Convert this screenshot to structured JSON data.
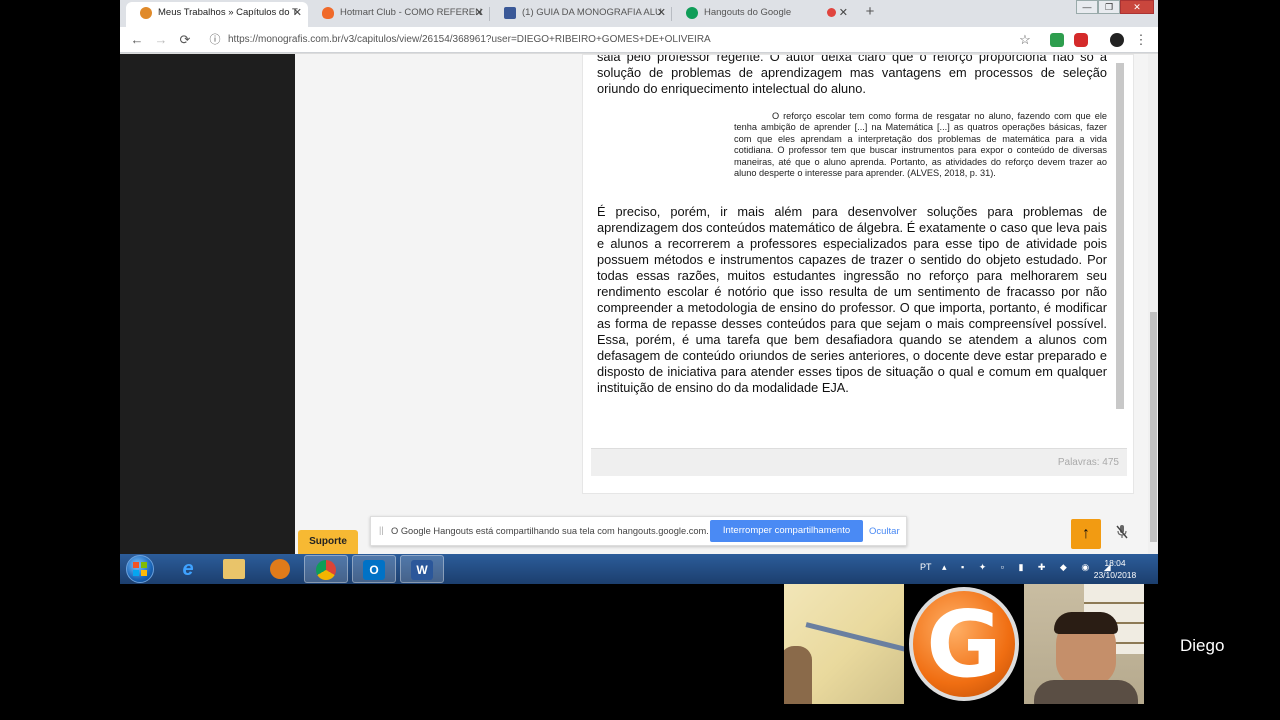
{
  "browser": {
    "tabs": [
      {
        "title": "Meus Trabalhos » Capítulos do T",
        "icon": "gear-icon",
        "active": true
      },
      {
        "title": "Hotmart Club - COMO REFEREN",
        "icon": "flame-icon",
        "active": false
      },
      {
        "title": "(1) GUIA DA MONOGRAFIA ALU",
        "icon": "facebook-icon",
        "active": false
      },
      {
        "title": "Hangouts do Google",
        "icon": "hangouts-icon",
        "active": false
      }
    ],
    "close_glyph": "✕",
    "new_tab_glyph": "+",
    "window_controls": {
      "minimize": "—",
      "maximize": "❐",
      "close": "✕"
    },
    "url": "https://monografis.com.br/v3/capitulos/view/26154/368961?user=DIEGO+RIBEIRO+GOMES+DE+OLIVEIRA",
    "nav": {
      "back": "←",
      "forward": "→",
      "reload": "⟳",
      "info": "ⓘ"
    },
    "toolbar_icons": {
      "star": "☆",
      "menu": "⋮"
    }
  },
  "document": {
    "paragraph_top": "sala pelo professor regente. O autor deixa claro que o reforço proporciona não só a solução de problemas de aprendizagem mas vantagens em processos de seleção oriundo do enriquecimento intelectual do aluno.",
    "quote": "O reforço escolar tem como forma de resgatar no aluno, fazendo com que ele tenha ambição de aprender [...] na Matemática [...] as quatros operações básicas, fazer com que eles aprendam a interpretação dos problemas de matemática para a vida cotidiana. O professor tem que buscar instrumentos para expor o conteúdo de diversas maneiras, até que o aluno aprenda. Portanto, as atividades do reforço devem trazer ao aluno desperte o interesse para aprender. (ALVES, 2018, p. 31).",
    "paragraph_main": " É preciso, porém, ir mais além para desenvolver soluções para problemas de aprendizagem dos conteúdos matemático de álgebra. É exatamente o caso que leva  pais e alunos a recorrerem a professores especializados para esse tipo de atividade  pois possuem métodos e instrumentos capazes de trazer o sentido do objeto estudado. Por todas essas razões, muitos estudantes ingressão no reforço para melhorarem seu rendimento escolar é notório que isso resulta de um sentimento de fracasso por não compreender a metodologia de ensino do professor. O que importa, portanto, é modificar as forma de repasse desses conteúdos para que sejam o mais compreensível possível. Essa, porém, é uma tarefa que bem desafiadora quando se atendem a alunos com defasagem de conteúdo oriundos de series anteriores, o docente deve estar preparado e disposto de iniciativa  para atender esses tipos de situação o qual e comum em qualquer instituição de ensino do da modalidade EJA.",
    "word_count": "Palavras: 475",
    "scroll_position": 0.9
  },
  "support_label": "Suporte",
  "share_bar": {
    "message": "O Google Hangouts está compartilhando sua tela com hangouts.google.com.",
    "stop_label": "Interromper compartilhamento",
    "hide_label": "Ocultar"
  },
  "scroll_top_glyph": "↑",
  "taskbar": {
    "apps": [
      "internet-explorer",
      "windows-explorer",
      "media-player",
      "chrome",
      "outlook",
      "word"
    ],
    "outlook_letter": "O",
    "word_letter": "W",
    "language": "PT",
    "time": "18:04",
    "date": "23/10/2018"
  },
  "hangouts": {
    "participants": [
      "camera-feed-1",
      "logo-g",
      "camera-feed-diego"
    ],
    "logo_letter": "G",
    "speaker_name": "Diego"
  },
  "colors": {
    "accent_blue": "#4a8af4",
    "support_yellow": "#f7b933",
    "scroll_top_orange": "#f29b12",
    "taskbar_blue": "#2c5d9a"
  }
}
